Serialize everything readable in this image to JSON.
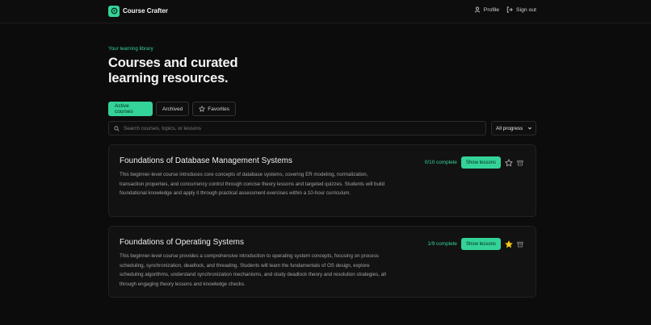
{
  "app": {
    "name": "Course Crafter"
  },
  "nav": {
    "profile": "Profile",
    "sign_out": "Sign out"
  },
  "hero": {
    "eyebrow": "Your learning library",
    "title_line1": "Courses and curated",
    "title_line2": "learning resources."
  },
  "tabs": {
    "active": "Active courses",
    "archived": "Archived",
    "favorites": "Favorites"
  },
  "search": {
    "placeholder": "Search courses, topics, or lessons",
    "value": ""
  },
  "filter": {
    "selected": "All progress"
  },
  "courses": [
    {
      "title": "Foundations of Database Management Systems",
      "description": "This beginner-level course introduces core concepts of database systems, covering ER modeling, normalization, transaction properties, and concurrency control through concise theory lessons and targeted quizzes. Students will build foundational knowledge and apply it through practical assessment exercises within a 10-hour curriculum.",
      "progress": "0/10 complete",
      "button": "Show lessons",
      "favorite": false
    },
    {
      "title": "Foundations of Operating Systems",
      "description": "This beginner-level course provides a comprehensive introduction to operating system concepts, focusing on process scheduling, synchronization, deadlock, and threading. Students will learn the fundamentals of OS design, explore scheduling algorithms, understand synchronization mechanisms, and study deadlock theory and resolution strategies, all through engaging theory lessons and knowledge checks.",
      "progress": "1/9 complete",
      "button": "Show lessons",
      "favorite": true
    }
  ],
  "colors": {
    "accent": "#34d399",
    "background": "#0c0c0c",
    "card": "#121212",
    "star_active": "#facc15"
  }
}
